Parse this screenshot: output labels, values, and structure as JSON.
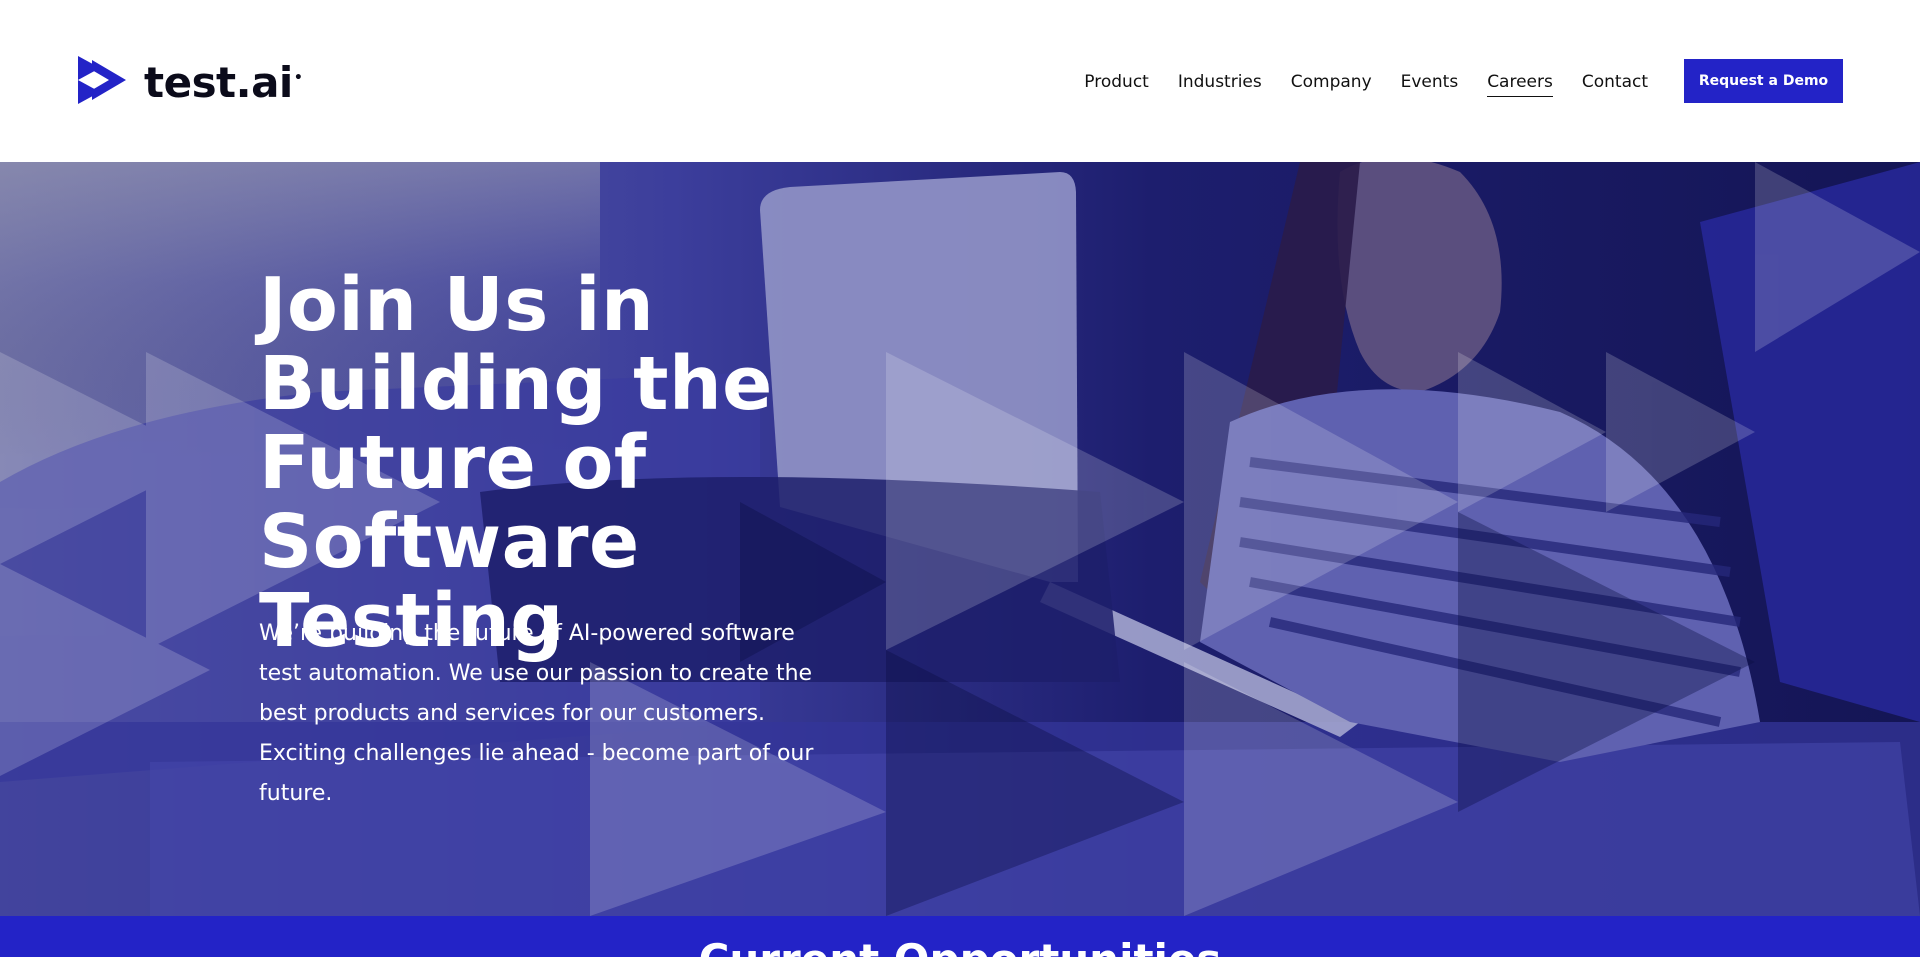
{
  "brand": {
    "name": "test.ai",
    "accent": "#2323c7",
    "hero_overlay": "#1c1c7a"
  },
  "nav": {
    "items": [
      {
        "label": "Product"
      },
      {
        "label": "Industries"
      },
      {
        "label": "Company"
      },
      {
        "label": "Events"
      },
      {
        "label": "Careers",
        "active": true
      },
      {
        "label": "Contact"
      }
    ],
    "cta_label": "Request a Demo"
  },
  "hero": {
    "title": "Join Us in Building the Future of Software Testing",
    "body": "We’re building the future of AI-powered software test automation. We use our passion to create the best products and services for our customers. Exciting challenges lie ahead - become part of our future.",
    "image_icon": "woman-on-couch-with-laptop-photo"
  },
  "opportunities": {
    "title": "Current Opportunities"
  }
}
